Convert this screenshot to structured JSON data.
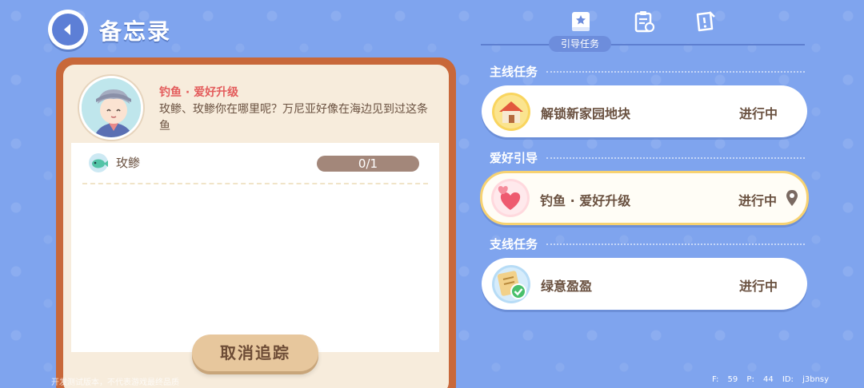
{
  "header": {
    "title": "备忘录"
  },
  "memo": {
    "quest_title": "钓鱼 · 爱好升级",
    "quest_desc": "玫鲹、玫鲹你在哪里呢？万尼亚好像在海边见到过这条鱼",
    "objective_label": "玫鲹",
    "progress_text": "0/1",
    "progress_fraction": 0,
    "cancel_button": "取消追踪"
  },
  "tabs": {
    "active_label": "引导任务",
    "icons": [
      "guide-book-icon",
      "clipboard-icon",
      "quest-note-icon"
    ]
  },
  "sections": [
    {
      "title": "主线任务",
      "items": [
        {
          "name": "解锁新家园地块",
          "status": "进行中",
          "icon": "house-icon"
        }
      ]
    },
    {
      "title": "爱好引导",
      "items": [
        {
          "name": "钓鱼 · 爱好升级",
          "status": "进行中",
          "icon": "hearts-icon",
          "selected": true
        }
      ]
    },
    {
      "title": "支线任务",
      "items": [
        {
          "name": "绿意盈盈",
          "status": "进行中",
          "icon": "note-check-icon"
        }
      ]
    }
  ],
  "footer": {
    "notice": "开发测试版本，不代表游戏最终品质",
    "stats": "F: 59   P: 44   ID: j3bnsy"
  },
  "colors": {
    "background": "#7fa4ee",
    "card_border": "#c8683a",
    "card_bg": "#f7ecdc",
    "accent_red": "#e35b5b",
    "selected_border": "#f7d271"
  }
}
